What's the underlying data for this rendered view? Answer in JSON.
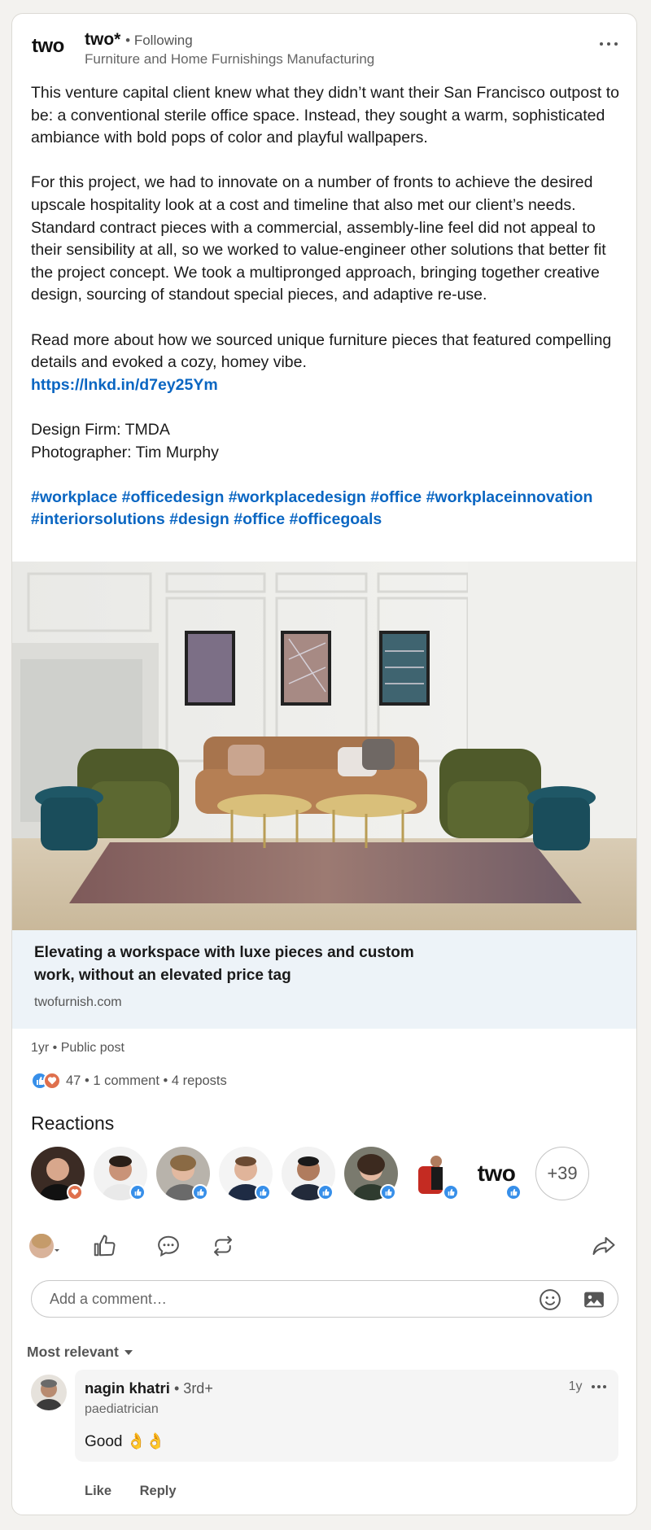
{
  "post": {
    "author": {
      "logo_text": "two",
      "name": "two*",
      "following": "• Following",
      "industry": "Furniture and Home Furnishings Manufacturing",
      "more_icon": "ellipsis-icon"
    },
    "paragraphs": {
      "p1": "This venture capital client knew what they didn’t want their San Francisco outpost to be: a conventional sterile office space. Instead, they sought a warm, sophisticated ambiance with bold pops of color and playful wallpapers.",
      "p2": "For this project, we had to innovate on a number of fronts to achieve the desired upscale hospitality look at a cost and timeline that also met our client’s needs. Standard contract pieces with a commercial, assembly-line feel did not appeal to their sensibility at all, so we worked to value-engineer other solutions that better fit the project concept. We took a multipronged approach, bringing together creative design, sourcing of standout special pieces, and adaptive re-use.",
      "p3": "Read more about how we sourced unique furniture pieces that featured compelling details and evoked a cozy, homey vibe.",
      "link": "https://lnkd.in/d7ey25Ym",
      "credit_firm": "Design Firm: TMDA",
      "credit_photo": "Photographer: Tim Murphy"
    },
    "hashtags": [
      "#workplace",
      "#officedesign",
      "#workplacedesign",
      "#office",
      "#workplaceinnovation",
      "#interiorsolutions",
      "#design",
      "#office",
      "#officegoals"
    ],
    "link_preview": {
      "title": "Elevating a workspace with luxe pieces and custom work, without an elevated price tag",
      "domain": "twofurnish.com"
    },
    "meta": "1yr • Public post",
    "reaction_count": "47",
    "comments_count": "1 comment",
    "reposts_count": "4 reposts",
    "sep": " • "
  },
  "reactions": {
    "title": "Reactions",
    "more": "+39",
    "avatar_text": "two"
  },
  "actions": {
    "like_icon": "thumbs-up-icon",
    "comment_icon": "comment-icon",
    "repost_icon": "repost-icon",
    "share_icon": "share-icon"
  },
  "comment_box": {
    "placeholder": "Add a comment…",
    "emoji_icon": "emoji-icon",
    "image_icon": "image-icon"
  },
  "comments": {
    "sort": "Most relevant",
    "items": [
      {
        "name": "nagin khatri",
        "degree": "• 3rd+",
        "title": "paediatrician",
        "time": "1y",
        "text": "Good 👌👌",
        "like": "Like",
        "reply": "Reply"
      }
    ]
  },
  "colors": {
    "link": "#0a66c2",
    "like_badge": "#378fe9",
    "love_badge": "#df704d",
    "preview_bg": "#edf3f8"
  }
}
